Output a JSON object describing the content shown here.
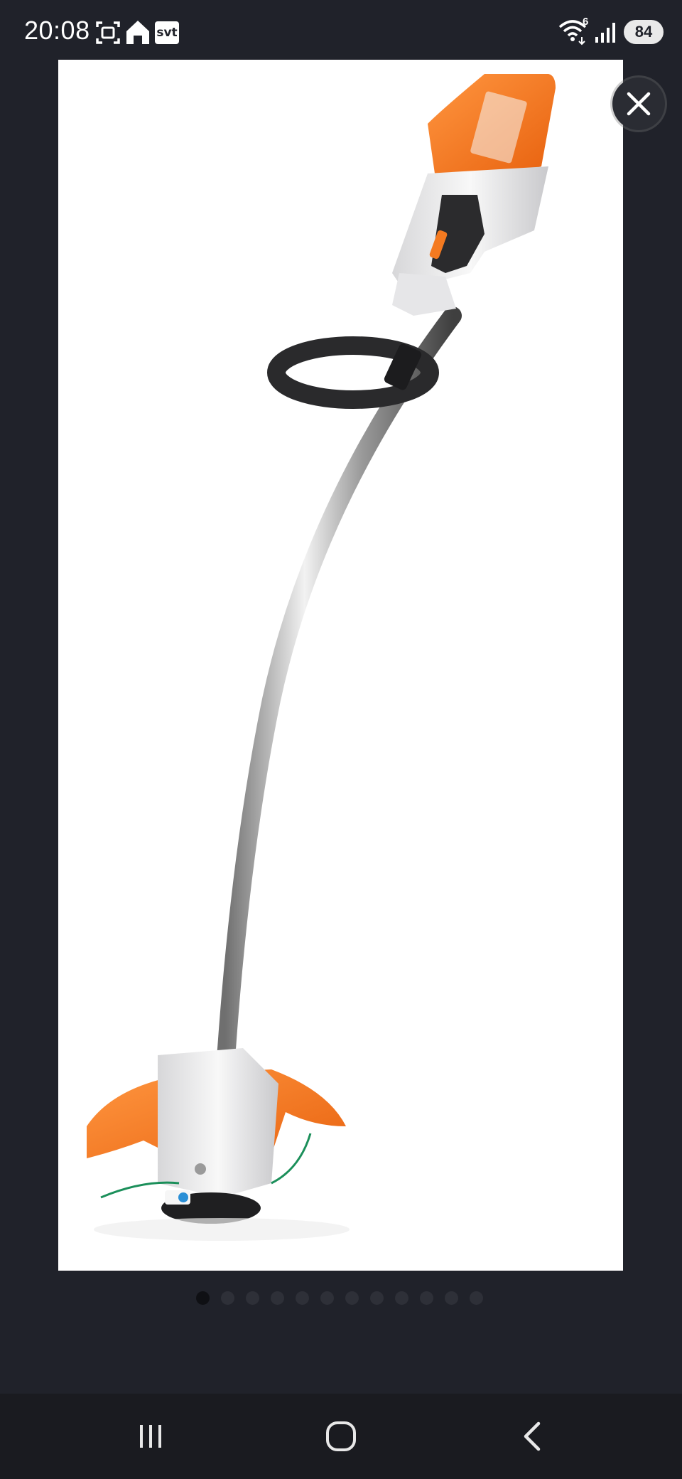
{
  "status_bar": {
    "time": "20:08",
    "notification_icons": [
      "screenshot-icon",
      "home-app-icon",
      "svt-app-icon"
    ],
    "svt_label": "svt",
    "wifi_label": "6",
    "battery_level": "84"
  },
  "viewer": {
    "image_description_icon": "string-trimmer-image",
    "close_icon": "close-icon",
    "page_count": 12,
    "current_page": 1
  },
  "nav_bar": {
    "buttons": [
      "recent-apps-icon",
      "home-icon",
      "back-icon"
    ]
  },
  "colors": {
    "background": "#20222a",
    "accent_orange": "#f47a20",
    "dot_active": "#0f1014",
    "dot_inactive": "#2e3038"
  }
}
